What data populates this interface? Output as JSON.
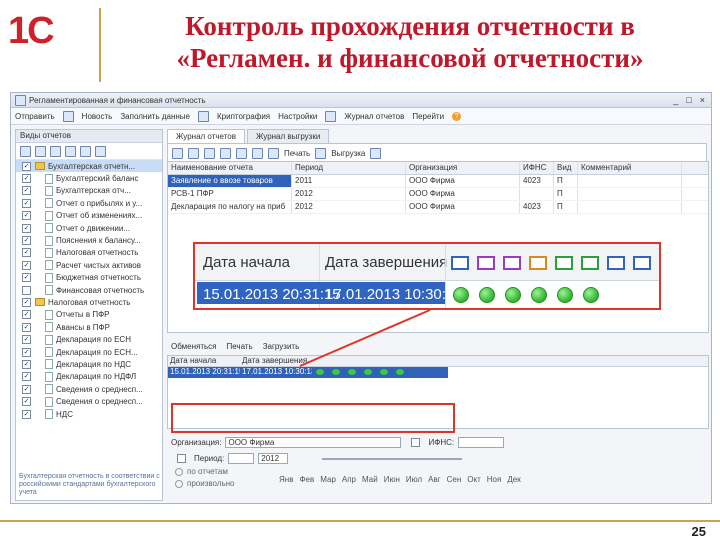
{
  "header": {
    "logo": "1C",
    "title_line1": "Контроль прохождения отчетности в",
    "title_line2": "«Регламен. и финансовой отчетности»"
  },
  "window": {
    "title": "Регламентированная и финансовая отчетность",
    "controls": [
      "_",
      "□",
      "×"
    ],
    "menu": [
      "Отправить",
      "Новость",
      "Заполнить данные",
      "Криптография",
      "Настройки",
      "Журнал отчетов",
      "Перейти"
    ]
  },
  "left_panel": {
    "header": "Виды отчетов",
    "tree": [
      {
        "label": "Бухгалтерская отчетн...",
        "level": 0,
        "checked": true,
        "folder": true,
        "selected": true
      },
      {
        "label": "Бухгалтерский баланс",
        "level": 1,
        "checked": true
      },
      {
        "label": "Бухгалтерская отч...",
        "level": 1,
        "checked": true
      },
      {
        "label": "Отчет о прибылях и у...",
        "level": 1,
        "checked": true
      },
      {
        "label": "Отчет об изменениях...",
        "level": 1,
        "checked": true
      },
      {
        "label": "Отчет о движении...",
        "level": 1,
        "checked": true
      },
      {
        "label": "Пояснения к балансу...",
        "level": 1,
        "checked": true
      },
      {
        "label": "Налоговая отчетность",
        "level": 1,
        "checked": true
      },
      {
        "label": "Расчет чистых активов",
        "level": 1,
        "checked": true
      },
      {
        "label": "Бюджетная отчетность",
        "level": 1,
        "checked": true
      },
      {
        "label": "Финансовая отчетность",
        "level": 1,
        "checked": false
      },
      {
        "label": "Налоговая отчетность",
        "level": 0,
        "checked": true,
        "folder": true
      },
      {
        "label": "Отчеты в ПФР",
        "level": 1,
        "checked": true
      },
      {
        "label": "Авансы в ПФР",
        "level": 1,
        "checked": true
      },
      {
        "label": "Декларация по ЕСН",
        "level": 1,
        "checked": true
      },
      {
        "label": "Декларация по ЕСН...",
        "level": 1,
        "checked": true
      },
      {
        "label": "Декларация по НДС",
        "level": 1,
        "checked": true
      },
      {
        "label": "Декларация по НДФЛ",
        "level": 1,
        "checked": true
      },
      {
        "label": "Сведения о среднесп...",
        "level": 1,
        "checked": true
      },
      {
        "label": "Сведения о среднесп...",
        "level": 1,
        "checked": true
      },
      {
        "label": "НДС",
        "level": 1,
        "checked": true
      }
    ],
    "footer": "Бухгалтерская отчетность в соответствии с российскими стандартами бухгалтерского учета"
  },
  "tabs": [
    "Журнал отчетов",
    "Журнал выгрузки"
  ],
  "toolbar": {
    "print": "Печать",
    "upload": "Выгрузка"
  },
  "grid": {
    "columns": [
      "Наименование отчета",
      "Период",
      "Организация",
      "ИФНС",
      "Вид",
      "Комментарий"
    ],
    "rows": [
      [
        "Заявление о ввозе товаров",
        "2011",
        "ООО Фирма",
        "4023",
        "П",
        ""
      ],
      [
        "РСВ-1 ПФР",
        "2012",
        "ООО Фирма",
        "",
        "П",
        ""
      ],
      [
        "Декларация по налогу на приб",
        "2012",
        "ООО Фирма",
        "4023",
        "П",
        ""
      ]
    ]
  },
  "bottom": {
    "toolbar": [
      "Обменяться",
      "Печать",
      "Загрузить"
    ],
    "columns": [
      "Дата начала",
      "Дата завершения"
    ],
    "row": {
      "start": "15.01.2013 20:31:15",
      "end": "17.01.2013 10:30:13"
    }
  },
  "filters": {
    "org_label": "Организация:",
    "org_value": "ООО Фирма",
    "ifns_label": "ИФНС:",
    "period_label": "Период:",
    "year": "2012",
    "radio1": "по отчетам",
    "radio2": "произвольно",
    "months": [
      "Янв",
      "Фев",
      "Мар",
      "Апр",
      "Май",
      "Июн",
      "Июл",
      "Авг",
      "Сен",
      "Окт",
      "Ноя",
      "Дек"
    ]
  },
  "zoom": {
    "col1": "Дата начала",
    "col2": "Дата завершения",
    "start": "15.01.2013 20:31:15",
    "end": "17.01.2013 10:30:13"
  },
  "page_number": "25",
  "colors": {
    "title": "#c0182a",
    "accent_line": "#c9a640",
    "selection": "#2f64c0",
    "highlight_box": "#e0342a"
  }
}
